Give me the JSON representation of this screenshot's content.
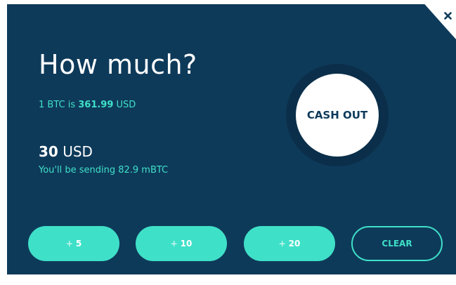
{
  "close": {
    "icon": "close-icon",
    "glyph": "✖"
  },
  "heading": "How much?",
  "rate": {
    "prefix": "1 BTC is ",
    "value": "361.99",
    "suffix": " USD"
  },
  "amount": {
    "value": "30",
    "unit": " USD"
  },
  "sending_text": "You'll be sending 82.9 mBTC",
  "cashout_label": "CASH OUT",
  "buttons": [
    {
      "plus": "+",
      "value": "5"
    },
    {
      "plus": "+",
      "value": "10"
    },
    {
      "plus": "+",
      "value": "20"
    }
  ],
  "clear_label": "CLEAR",
  "colors": {
    "panel": "#0e3a5a",
    "accent": "#3fe0c8",
    "ring": "#0b2f4a",
    "text": "#ffffff"
  }
}
